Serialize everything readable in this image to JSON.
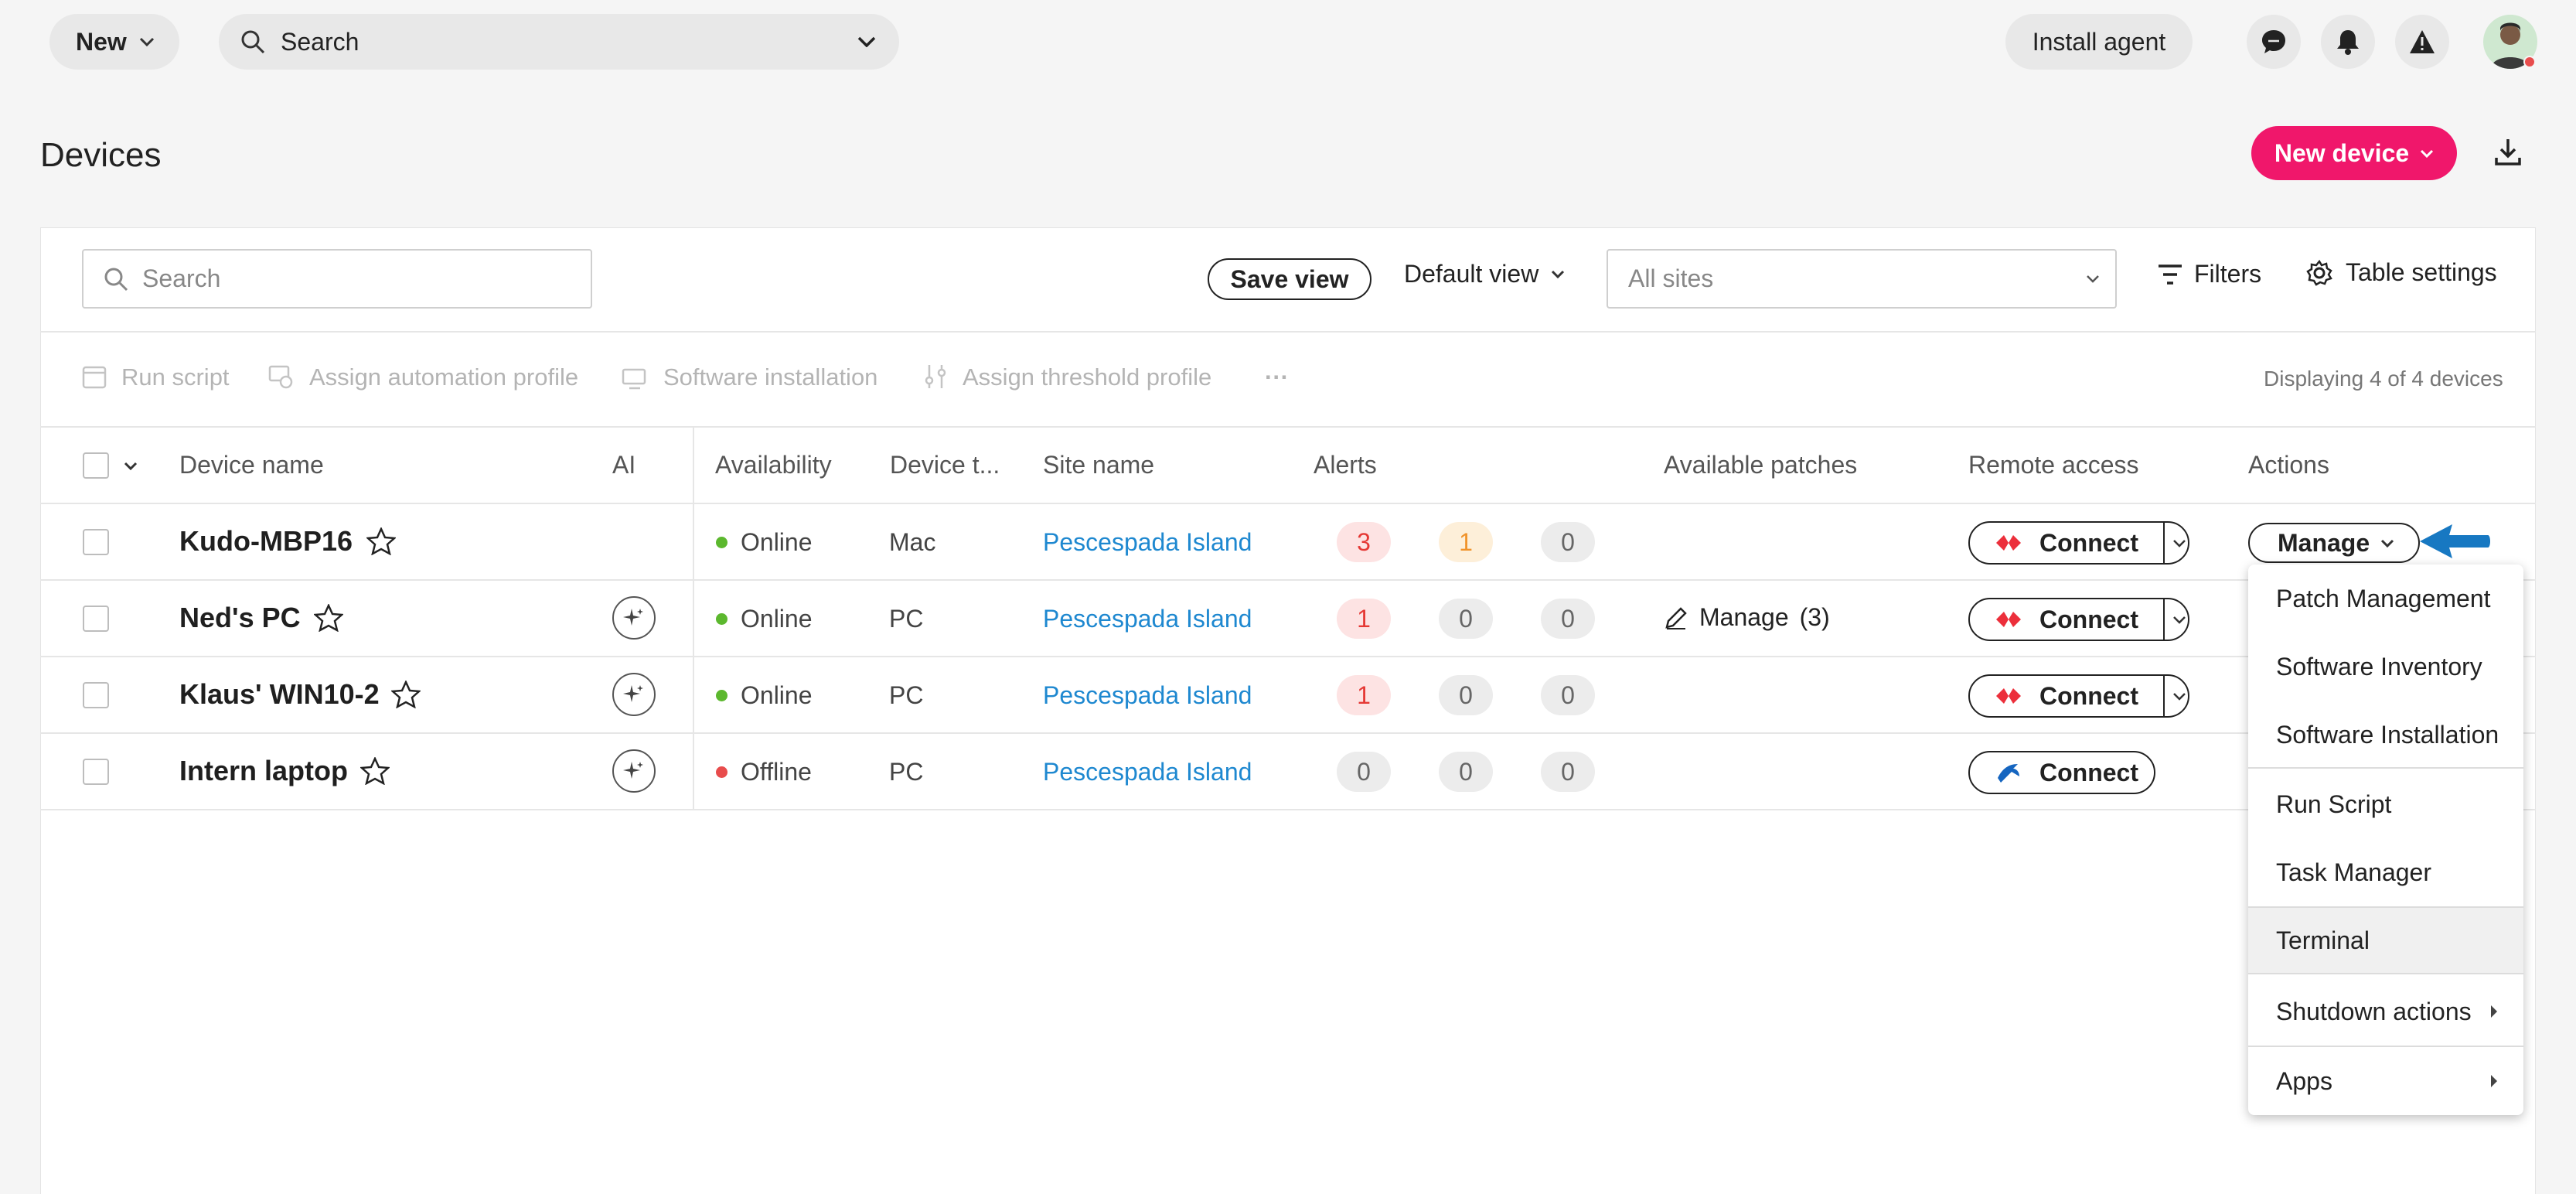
{
  "topbar": {
    "new_label": "New",
    "search_label": "Search",
    "install_agent_label": "Install agent"
  },
  "page": {
    "title": "Devices",
    "new_device_label": "New device"
  },
  "filterbar": {
    "search_placeholder": "Search",
    "save_view_label": "Save view",
    "default_view_label": "Default view",
    "sites_placeholder": "All sites",
    "filters_label": "Filters",
    "table_settings_label": "Table settings"
  },
  "bulk_actions": {
    "run_script": "Run script",
    "assign_automation_profile": "Assign automation profile",
    "software_installation": "Software installation",
    "assign_threshold_profile": "Assign threshold profile",
    "more": "···",
    "display_count": "Displaying 4 of 4 devices"
  },
  "table": {
    "headers": {
      "device_name": "Device name",
      "ai": "AI",
      "availability": "Availability",
      "device_type": "Device t...",
      "site_name": "Site name",
      "alerts": "Alerts",
      "available_patches": "Available patches",
      "remote_access": "Remote access",
      "actions": "Actions"
    },
    "rows": [
      {
        "name": "Kudo-MBP16",
        "availability": "Online",
        "type": "Mac",
        "site": "Pescespada Island",
        "alerts": [
          "3",
          "1",
          "0"
        ],
        "patches": "",
        "connect": "Connect",
        "manage": "Manage"
      },
      {
        "name": "Ned's PC",
        "availability": "Online",
        "type": "PC",
        "site": "Pescespada Island",
        "alerts": [
          "1",
          "0",
          "0"
        ],
        "patches": "Manage",
        "patches_count": "(3)",
        "connect": "Connect"
      },
      {
        "name": "Klaus' WIN10-2",
        "availability": "Online",
        "type": "PC",
        "site": "Pescespada Island",
        "alerts": [
          "1",
          "0",
          "0"
        ],
        "patches": "",
        "connect": "Connect"
      },
      {
        "name": "Intern laptop",
        "availability": "Offline",
        "type": "PC",
        "site": "Pescespada Island",
        "alerts": [
          "0",
          "0",
          "0"
        ],
        "patches": "",
        "connect": "Connect"
      }
    ]
  },
  "manage_menu": {
    "items": [
      "Patch Management",
      "Software Inventory",
      "Software Installation",
      "Run Script",
      "Task Manager",
      "Terminal",
      "Shutdown actions",
      "Apps"
    ]
  },
  "colors": {
    "accent": "#f0176b",
    "online": "#5cb82e",
    "offline": "#e84c4c",
    "link": "#1e88d0",
    "arrow": "#1778c2"
  }
}
